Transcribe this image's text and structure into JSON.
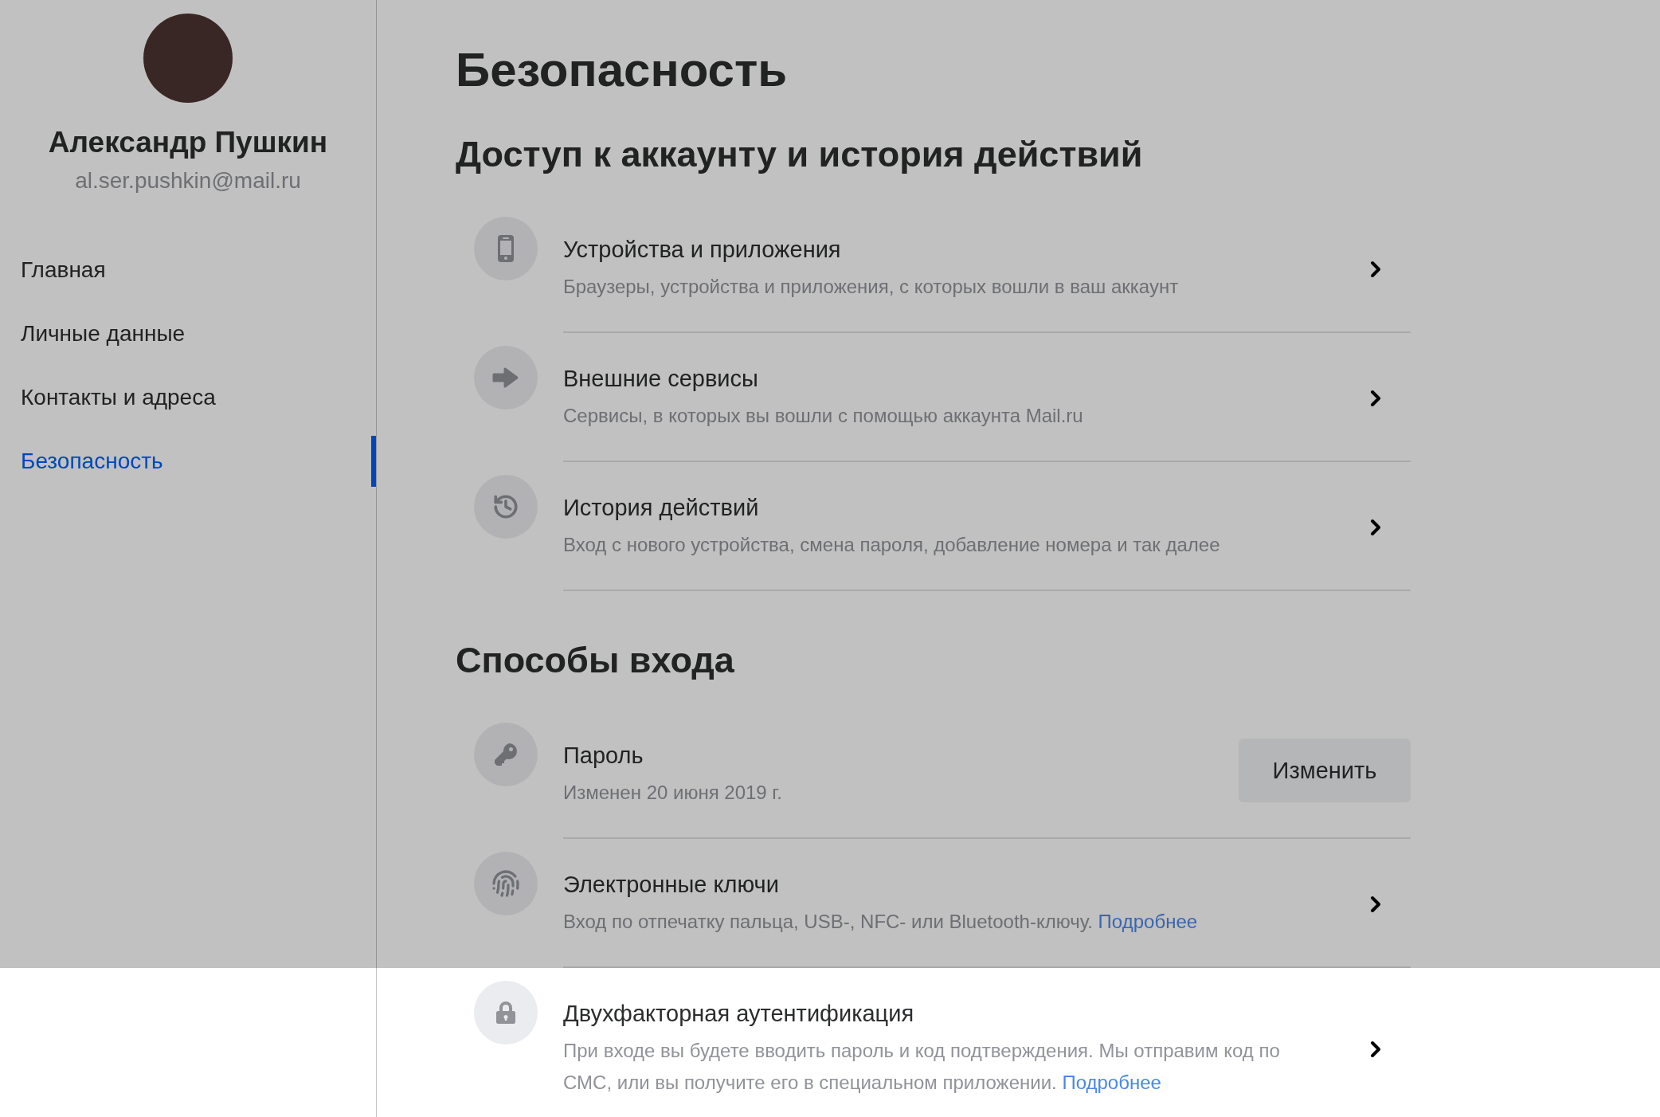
{
  "profile": {
    "name": "Александр Пушкин",
    "email": "al.ser.pushkin@mail.ru"
  },
  "nav": [
    {
      "label": "Главная",
      "selected": false
    },
    {
      "label": "Личные данные",
      "selected": false
    },
    {
      "label": "Контакты и адреса",
      "selected": false
    },
    {
      "label": "Безопасность",
      "selected": true
    }
  ],
  "page_title": "Безопасность",
  "sections": [
    {
      "title": "Доступ к аккаунту и история действий",
      "items": [
        {
          "kind": "phone",
          "title": "Устройства и приложения",
          "subtitle": "Браузеры, устройства и приложения, с которых вошли в ваш аккаунт",
          "action": {
            "kind": "chevron"
          },
          "highlighted": false
        },
        {
          "kind": "arrow",
          "title": "Внешние сервисы",
          "subtitle": "Сервисы, в которых вы вошли с помощью аккаунта Mail.ru",
          "action": {
            "kind": "chevron"
          },
          "highlighted": false
        },
        {
          "kind": "history",
          "title": "История действий",
          "subtitle": "Вход с нового устройства, смена пароля, добавление номера и так далее",
          "action": {
            "kind": "chevron"
          },
          "highlighted": false
        }
      ]
    },
    {
      "title": "Способы входа",
      "items": [
        {
          "kind": "key",
          "title": "Пароль",
          "subtitle": "Изменен 20 июня 2019 г.",
          "action": {
            "kind": "button",
            "label": "Изменить"
          },
          "highlighted": false
        },
        {
          "kind": "fingerprint",
          "title": "Электронные ключи",
          "subtitle": "Вход по отпечатку пальца, USB-, NFC- или Bluetooth-ключу.",
          "link": "Подробнее",
          "action": {
            "kind": "chevron"
          },
          "highlighted": false
        },
        {
          "kind": "lock",
          "title": "Двухфакторная аутентификация",
          "subtitle": "При входе вы будете вводить пароль и код подтверждения. Мы отправим код по СМС, или вы получите его в специальном приложении.",
          "link": "Подробнее",
          "action": {
            "kind": "chevron"
          },
          "highlighted": true
        }
      ]
    }
  ]
}
